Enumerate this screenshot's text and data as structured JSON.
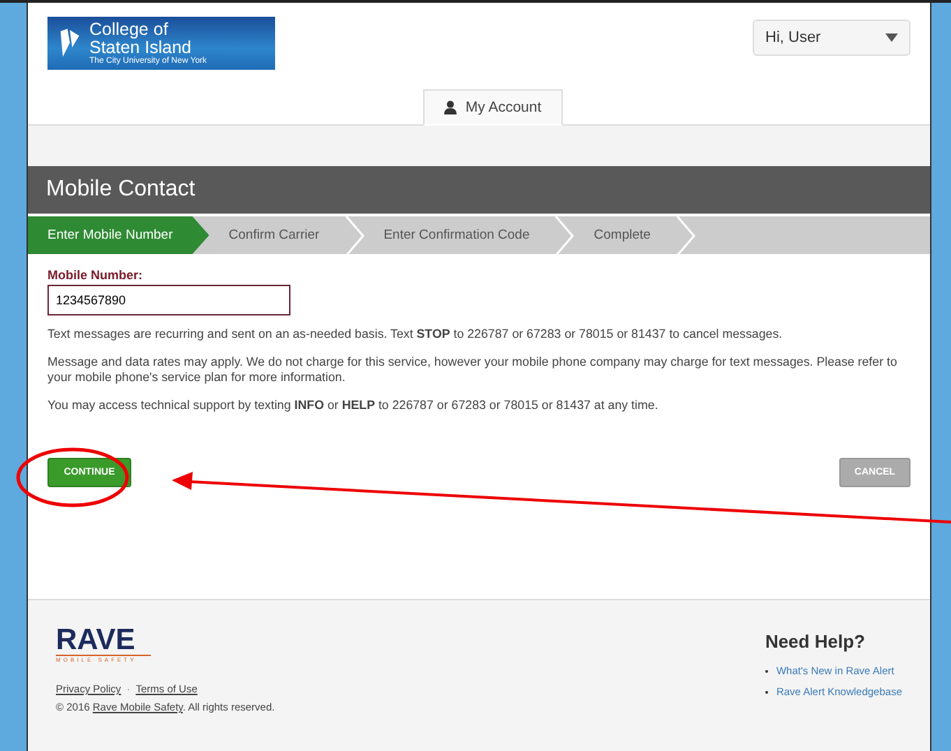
{
  "header": {
    "logo": {
      "line1": "College of",
      "line2": "Staten Island",
      "line3": "The City University of New York"
    },
    "user_menu": "Hi, User",
    "tabs": [
      {
        "label": "My Account",
        "selected": true
      }
    ]
  },
  "panel": {
    "title": "Mobile Contact",
    "steps": [
      {
        "label": "Enter Mobile Number",
        "selected": true
      },
      {
        "label": "Confirm Carrier",
        "selected": false
      },
      {
        "label": "Enter Confirmation Code",
        "selected": false
      },
      {
        "label": "Complete",
        "selected": false
      }
    ],
    "field": {
      "label": "Mobile Number:",
      "value": "1234567890"
    },
    "paragraphs": [
      "Text messages are recurring and sent on an as-needed basis. Text **STOP** to 226787 or 67283 or 78015 or 81437 to cancel messages.",
      "Message and data rates may apply. We do not charge for this service, however your mobile phone company may charge for text messages. Please refer to your mobile phone's service plan for more information.",
      "You may access technical support by texting **INFO** or **HELP** to 226787 or 67283 or 78015 or 81437 at any time."
    ],
    "buttons": [
      {
        "label": "CONTINUE",
        "disabled": false
      },
      {
        "label": "CANCEL",
        "disabled": true
      }
    ]
  },
  "footer": {
    "brand": {
      "name": "RAVE",
      "tagline": "MOBILE SAFETY"
    },
    "links": [
      "Privacy Policy",
      "Terms of Use"
    ],
    "link_separator": "·",
    "copyright": {
      "before": "© 2016",
      "link": "Rave Mobile Safety",
      "after": ". All rights reserved."
    },
    "help": {
      "title": "Need Help?",
      "links": [
        "What's New in Rave Alert",
        "Rave Alert Knowledgebase"
      ]
    }
  }
}
